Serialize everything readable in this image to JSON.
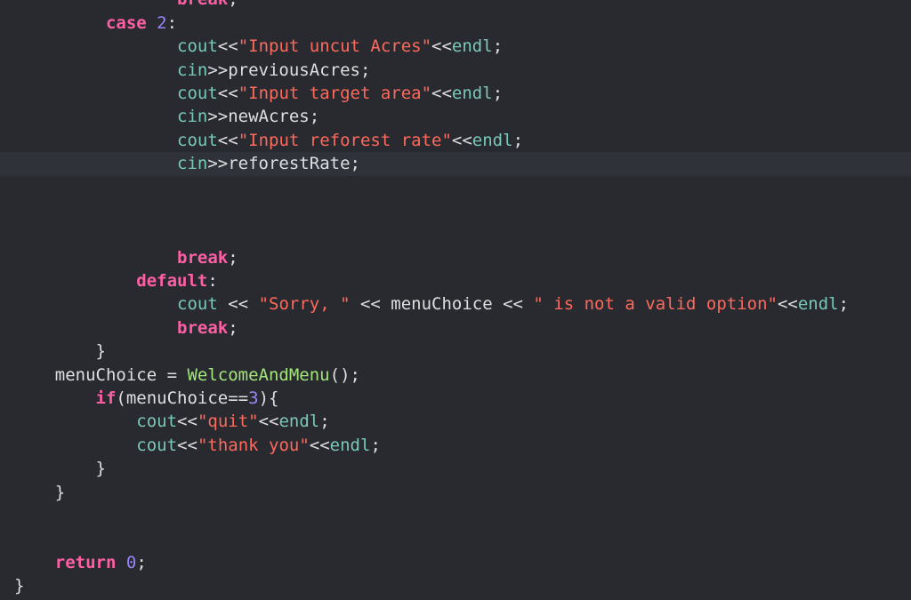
{
  "editor": {
    "theme_colors": {
      "background": "#292A30",
      "current_line": "#2F3239",
      "keyword": "#FC5FA3",
      "string": "#FC6A5D",
      "number": "#9686F5",
      "library": "#7AC8B6",
      "function": "#A3E57A",
      "text": "#DFDFE0"
    },
    "current_line_index": 7,
    "lines": [
      [
        [
          "plain",
          "                "
        ],
        [
          "kw",
          "break"
        ],
        [
          "plain",
          ";"
        ]
      ],
      [
        [
          "plain",
          "         "
        ],
        [
          "kw",
          "case"
        ],
        [
          "plain",
          " "
        ],
        [
          "num",
          "2"
        ],
        [
          "plain",
          ":"
        ]
      ],
      [
        [
          "plain",
          "                "
        ],
        [
          "lib",
          "cout"
        ],
        [
          "plain",
          "<<"
        ],
        [
          "str",
          "\"Input uncut Acres\""
        ],
        [
          "plain",
          "<<"
        ],
        [
          "lib",
          "endl"
        ],
        [
          "plain",
          ";"
        ]
      ],
      [
        [
          "plain",
          "                "
        ],
        [
          "lib",
          "cin"
        ],
        [
          "plain",
          ">>previousAcres;"
        ]
      ],
      [
        [
          "plain",
          "                "
        ],
        [
          "lib",
          "cout"
        ],
        [
          "plain",
          "<<"
        ],
        [
          "str",
          "\"Input target area\""
        ],
        [
          "plain",
          "<<"
        ],
        [
          "lib",
          "endl"
        ],
        [
          "plain",
          ";"
        ]
      ],
      [
        [
          "plain",
          "                "
        ],
        [
          "lib",
          "cin"
        ],
        [
          "plain",
          ">>newAcres;"
        ]
      ],
      [
        [
          "plain",
          "                "
        ],
        [
          "lib",
          "cout"
        ],
        [
          "plain",
          "<<"
        ],
        [
          "str",
          "\"Input reforest rate\""
        ],
        [
          "plain",
          "<<"
        ],
        [
          "lib",
          "endl"
        ],
        [
          "plain",
          ";"
        ]
      ],
      [
        [
          "plain",
          "                "
        ],
        [
          "lib",
          "cin"
        ],
        [
          "plain",
          ">>reforestRate;"
        ]
      ],
      [],
      [],
      [],
      [
        [
          "plain",
          "                "
        ],
        [
          "kw",
          "break"
        ],
        [
          "plain",
          ";"
        ]
      ],
      [
        [
          "plain",
          "            "
        ],
        [
          "kw",
          "default"
        ],
        [
          "plain",
          ":"
        ]
      ],
      [
        [
          "plain",
          "                "
        ],
        [
          "lib",
          "cout"
        ],
        [
          "plain",
          " << "
        ],
        [
          "str",
          "\"Sorry, \""
        ],
        [
          "plain",
          " << menuChoice << "
        ],
        [
          "str",
          "\" is not a valid option\""
        ],
        [
          "plain",
          "<<"
        ],
        [
          "lib",
          "endl"
        ],
        [
          "plain",
          ";"
        ]
      ],
      [
        [
          "plain",
          "                "
        ],
        [
          "kw",
          "break"
        ],
        [
          "plain",
          ";"
        ]
      ],
      [
        [
          "plain",
          "        }"
        ]
      ],
      [
        [
          "plain",
          "    menuChoice = "
        ],
        [
          "fn",
          "WelcomeAndMenu"
        ],
        [
          "plain",
          "();"
        ]
      ],
      [
        [
          "plain",
          "        "
        ],
        [
          "kw",
          "if"
        ],
        [
          "plain",
          "(menuChoice=="
        ],
        [
          "num",
          "3"
        ],
        [
          "plain",
          "){"
        ]
      ],
      [
        [
          "plain",
          "            "
        ],
        [
          "lib",
          "cout"
        ],
        [
          "plain",
          "<<"
        ],
        [
          "str",
          "\"quit\""
        ],
        [
          "plain",
          "<<"
        ],
        [
          "lib",
          "endl"
        ],
        [
          "plain",
          ";"
        ]
      ],
      [
        [
          "plain",
          "            "
        ],
        [
          "lib",
          "cout"
        ],
        [
          "plain",
          "<<"
        ],
        [
          "str",
          "\"thank you\""
        ],
        [
          "plain",
          "<<"
        ],
        [
          "lib",
          "endl"
        ],
        [
          "plain",
          ";"
        ]
      ],
      [
        [
          "plain",
          "        }"
        ]
      ],
      [
        [
          "plain",
          "    }"
        ]
      ],
      [],
      [],
      [
        [
          "plain",
          "    "
        ],
        [
          "kw",
          "return"
        ],
        [
          "plain",
          " "
        ],
        [
          "num",
          "0"
        ],
        [
          "plain",
          ";"
        ]
      ],
      [
        [
          "plain",
          "}"
        ]
      ]
    ]
  }
}
